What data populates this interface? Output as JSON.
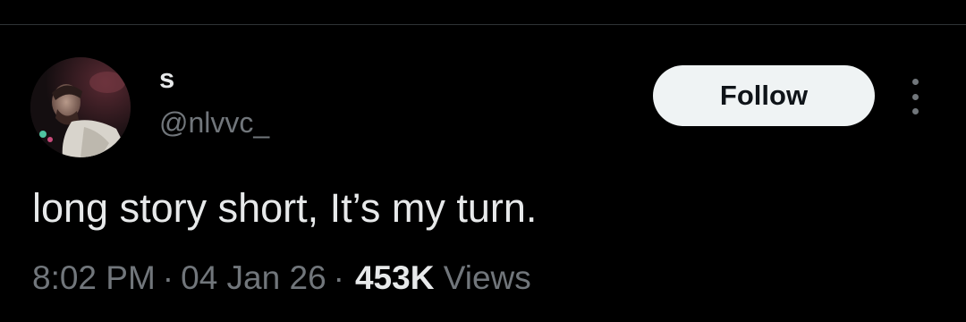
{
  "tweet": {
    "author": {
      "display_name": "s",
      "handle": "@nlvvc_",
      "avatar_icon": "profile-photo"
    },
    "follow_label": "Follow",
    "more_icon": "more-options-icon",
    "text": "long story short, It’s my turn.",
    "time": "8:02 PM",
    "separator": "·",
    "date": "04 Jan 26",
    "views_count": "453K",
    "views_label": "Views"
  },
  "colors": {
    "background": "#000000",
    "primary_text": "#e7e9ea",
    "secondary_text": "#71767b",
    "follow_button_bg": "#eff3f4",
    "follow_button_text": "#0f1419",
    "divider": "#2f3336"
  }
}
